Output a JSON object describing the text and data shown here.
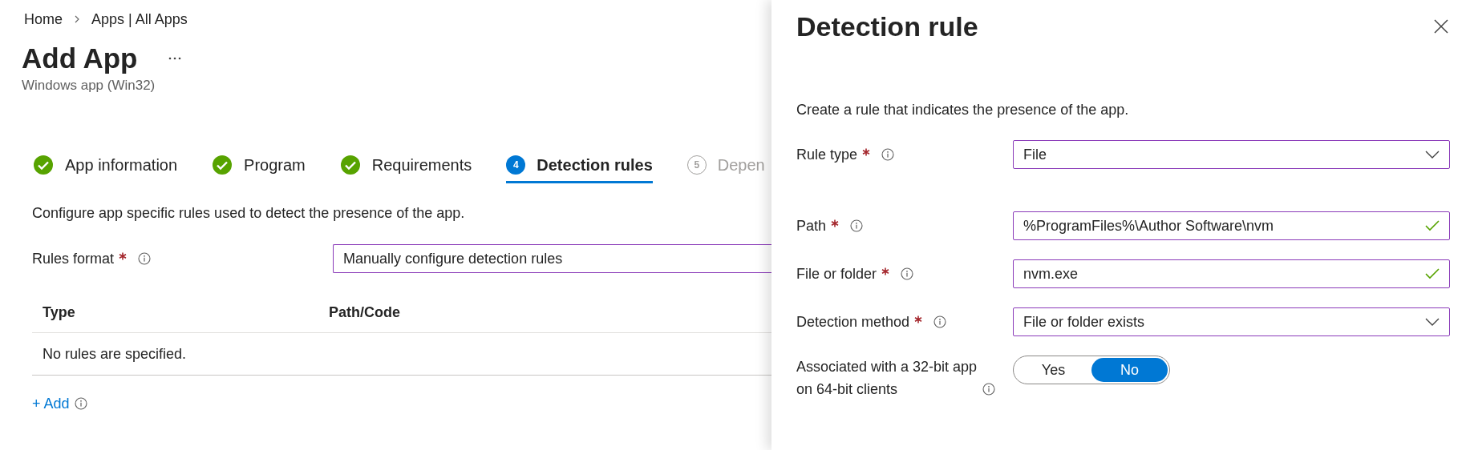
{
  "breadcrumb": [
    {
      "label": "Home"
    },
    {
      "label": "Apps | All Apps"
    }
  ],
  "title": "Add App",
  "subtitle": "Windows app (Win32)",
  "steps": [
    {
      "label": "App information",
      "completed": true,
      "disabled": false,
      "selected": false
    },
    {
      "label": "Program",
      "completed": true,
      "disabled": false,
      "selected": false
    },
    {
      "label": "Requirements",
      "completed": true,
      "disabled": false,
      "selected": false
    },
    {
      "number": "4",
      "label": "Detection rules",
      "completed": false,
      "disabled": false,
      "selected": true
    },
    {
      "number": "5",
      "label": "Depen",
      "completed": false,
      "disabled": true,
      "selected": false
    }
  ],
  "description": "Configure app specific rules used to detect the presence of the app.",
  "rules_format": {
    "label": "Rules format",
    "required": true,
    "value": "Manually configure detection rules"
  },
  "table": {
    "columns": [
      "Type",
      "Path/Code"
    ],
    "empty_message": "No rules are specified."
  },
  "add_link": "+ Add",
  "panel": {
    "title": "Detection rule",
    "description": "Create a rule that indicates the presence of the app.",
    "fields": [
      {
        "kind": "dropdown",
        "label": "Rule type",
        "required": true,
        "value": "File"
      },
      {
        "kind": "text",
        "label": "Path",
        "required": true,
        "value": "%ProgramFiles%\\Author Software\\nvm",
        "valid": true
      },
      {
        "kind": "text",
        "label": "File or folder",
        "required": true,
        "value": "nvm.exe",
        "valid": true
      },
      {
        "kind": "dropdown",
        "label": "Detection method",
        "required": true,
        "value": "File or folder exists"
      },
      {
        "kind": "toggle",
        "label": "Associated with a 32-bit app on 64-bit clients",
        "options": [
          {
            "label": "Yes",
            "selected": false
          },
          {
            "label": "No",
            "selected": true
          }
        ]
      }
    ]
  }
}
